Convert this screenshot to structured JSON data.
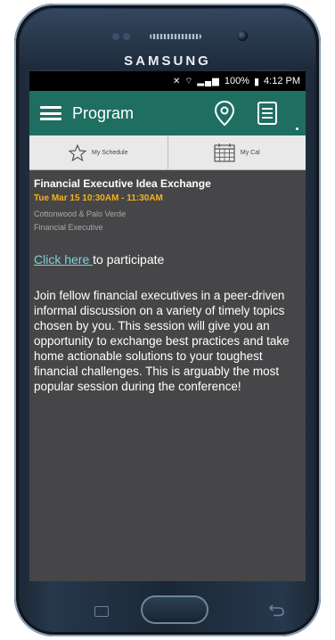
{
  "device": {
    "brand": "SAMSUNG"
  },
  "status_bar": {
    "battery": "100%",
    "time": "4:12 PM"
  },
  "app_bar": {
    "title": "Program",
    "icons": [
      "menu-icon",
      "map-pin-icon",
      "notes-icon"
    ],
    "color": "#1e6f62"
  },
  "tabs": [
    {
      "label": "My Schedule",
      "icon": "star-icon"
    },
    {
      "label": "My Cal",
      "icon": "calendar-icon"
    }
  ],
  "session": {
    "title": "Financial Executive Idea Exchange",
    "time": "Tue Mar 15 10:30AM - 11:30AM",
    "location": "Cottonwood & Palo Verde",
    "track": "Financial Executive",
    "link_text": "Click here ",
    "link_suffix": "to participate",
    "description": "Join fellow financial executives in a peer-driven informal discussion on a variety of timely topics chosen by you. This session will give you an opportunity to exchange best practices and take home actionable solutions to your toughest financial challenges. This is arguably the most popular session during the conference!"
  },
  "colors": {
    "accent_time": "#f3b31b",
    "link": "#7fd0de",
    "background": "#464648"
  }
}
